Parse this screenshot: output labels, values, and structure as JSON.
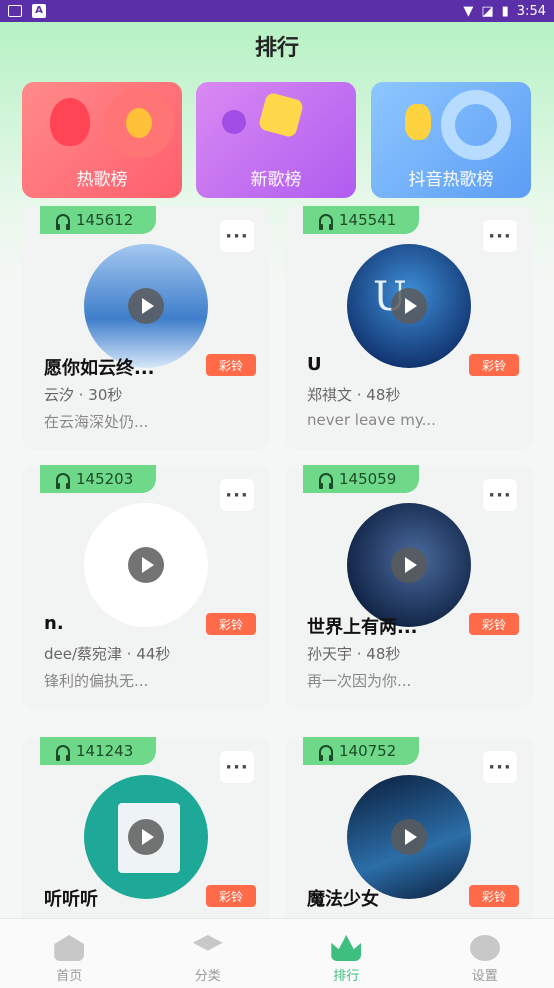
{
  "status": {
    "time": "3:54"
  },
  "header": {
    "title": "排行"
  },
  "categories": [
    {
      "label": "热歌榜"
    },
    {
      "label": "新歌榜"
    },
    {
      "label": "抖音热歌榜"
    }
  ],
  "songs": [
    {
      "count": "145612",
      "name": "愿你如云终...",
      "artist": "云汐  ·  30秒",
      "desc": "在云海深处仍...",
      "ring": "彩铃",
      "cover": "sky-clouds"
    },
    {
      "count": "145541",
      "name": "U",
      "artist": "郑祺文  ·  48秒",
      "desc": "never leave my...",
      "ring": "彩铃",
      "cover": "u-blue"
    },
    {
      "count": "145203",
      "name": "n.",
      "artist": "dee/蔡宛津  ·  44秒",
      "desc": "锋利的偏执无...",
      "ring": "彩铃",
      "cover": "blank-white"
    },
    {
      "count": "145059",
      "name": "世界上有两...",
      "artist": "孙天宇  ·  48秒",
      "desc": "再一次因为你...",
      "ring": "彩铃",
      "cover": "world-dark"
    },
    {
      "count": "141243",
      "name": "听听听",
      "artist": "",
      "desc": "",
      "ring": "彩铃",
      "cover": "teal-album"
    },
    {
      "count": "140752",
      "name": "魔法少女",
      "artist": "",
      "desc": "",
      "ring": "彩铃",
      "cover": "magic-girl"
    }
  ],
  "nav": [
    {
      "label": "首页",
      "icon": "home-icon"
    },
    {
      "label": "分类",
      "icon": "layers-icon"
    },
    {
      "label": "排行",
      "icon": "crown-icon"
    },
    {
      "label": "设置",
      "icon": "gear-icon"
    }
  ],
  "colors": {
    "accent": "#3fbf7f",
    "ring": "#ff6b48",
    "countBadge": "#6ed989"
  }
}
